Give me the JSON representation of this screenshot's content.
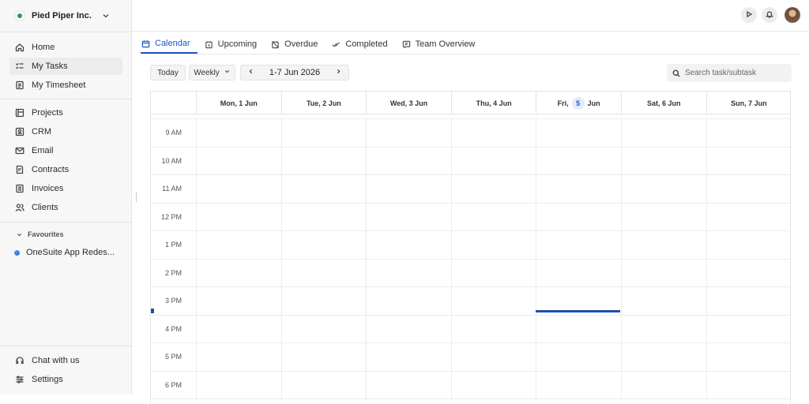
{
  "org": {
    "name": "Pied Piper Inc."
  },
  "nav": {
    "primary": [
      {
        "label": "Home",
        "icon": "home-icon"
      },
      {
        "label": "My Tasks",
        "icon": "tasks-icon",
        "active": true
      },
      {
        "label": "My Timesheet",
        "icon": "timesheet-icon"
      }
    ],
    "secondary": [
      {
        "label": "Projects",
        "icon": "projects-icon"
      },
      {
        "label": "CRM",
        "icon": "crm-icon"
      },
      {
        "label": "Email",
        "icon": "email-icon"
      },
      {
        "label": "Contracts",
        "icon": "contracts-icon"
      },
      {
        "label": "Invoices",
        "icon": "invoices-icon"
      },
      {
        "label": "Clients",
        "icon": "clients-icon"
      }
    ],
    "favourites_title": "Favourites",
    "favourites": [
      {
        "label": "OneSuite App Redes..."
      }
    ],
    "footer": [
      {
        "label": "Chat with us",
        "icon": "headset-icon"
      },
      {
        "label": "Settings",
        "icon": "settings-icon"
      }
    ]
  },
  "tabs": [
    {
      "label": "Calendar",
      "icon": "calendar-icon",
      "active": true
    },
    {
      "label": "Upcoming",
      "icon": "upcoming-icon"
    },
    {
      "label": "Overdue",
      "icon": "overdue-icon"
    },
    {
      "label": "Completed",
      "icon": "completed-icon"
    },
    {
      "label": "Team Overview",
      "icon": "team-overview-icon"
    }
  ],
  "toolbar": {
    "today_label": "Today",
    "view_label": "Weekly",
    "range_label": "1-7 Jun 2026",
    "search_placeholder": "Search task/subtask"
  },
  "calendar": {
    "days": [
      {
        "label": "Mon, 1 Jun"
      },
      {
        "label": "Tue, 2 Jun"
      },
      {
        "label": "Wed, 3 Jun"
      },
      {
        "label": "Thu, 4 Jun"
      },
      {
        "prefix": "Fri,",
        "date": "5",
        "suffix": "Jun",
        "today": true
      },
      {
        "label": "Sat, 6 Jun"
      },
      {
        "label": "Sun, 7 Jun"
      }
    ],
    "hours": [
      "9 AM",
      "10 AM",
      "11 AM",
      "12 PM",
      "1 PM",
      "2 PM",
      "3 PM",
      "4 PM",
      "5 PM",
      "6 PM"
    ]
  },
  "colors": {
    "accent": "#1a56c5",
    "now_line": "#1a4fb3"
  }
}
